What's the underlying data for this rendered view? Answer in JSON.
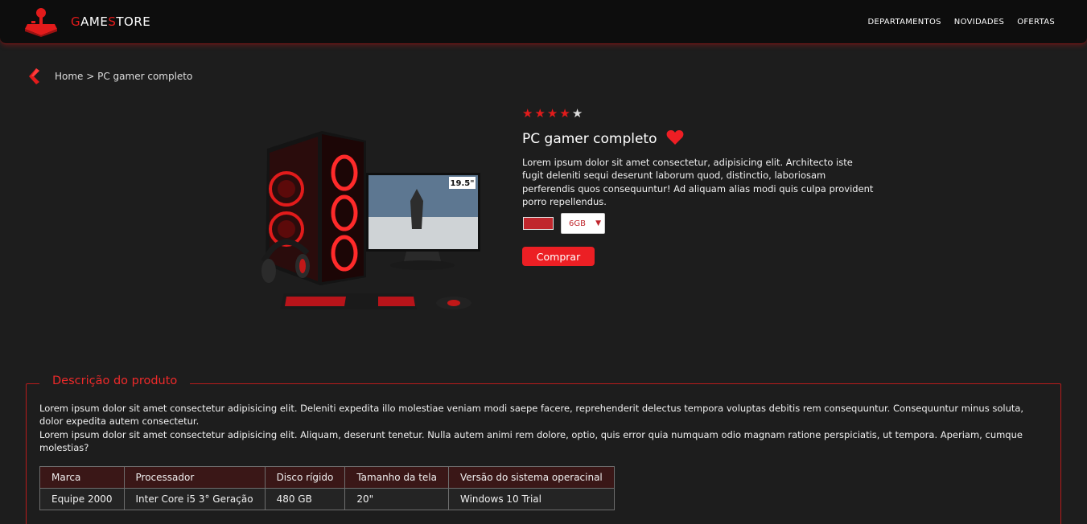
{
  "header": {
    "brand": {
      "g": "G",
      "ame": "AME",
      "s": "S",
      "tore": "TORE"
    },
    "nav": [
      "DEPARTAMENTOS",
      "NOVIDADES",
      "OFERTAS"
    ],
    "logo_icon": "joystick-icon"
  },
  "breadcrumb": {
    "text": "Home > PC gamer completo",
    "back_icon": "chevron-left-icon"
  },
  "product": {
    "image_icon": "gaming-pc-setup-image",
    "monitor_label": "19.5\"",
    "rating": 4,
    "rating_max": 5,
    "title": "PC gamer completo",
    "favorite_icon": "heart-icon",
    "description": "Lorem ipsum dolor sit amet consectetur, adipisicing elit. Architecto iste fugit deleniti sequi deserunt laborum quod, distinctio, laboriosam perferendis quos consequuntur! Ad aliquam alias modi quis culpa provident porro repellendus.",
    "color_swatch": "#c0272d",
    "memory_option": "6GB",
    "buy_label": "Comprar"
  },
  "details": {
    "legend": "Descrição do produto",
    "paragraph1": "Lorem ipsum dolor sit amet consectetur adipisicing elit. Deleniti expedita illo molestiae veniam modi saepe facere, reprehenderit delectus tempora voluptas debitis rem consequuntur. Consequuntur minus soluta, dolor expedita autem consectetur.",
    "paragraph2": "Lorem ipsum dolor sit amet consectetur adipisicing elit. Aliquam, deserunt tenetur. Nulla autem animi rem dolore, optio, quis error quia numquam odio magnam ratione perspiciatis, ut tempora. Aperiam, cumque molestias?",
    "table": {
      "headers": [
        "Marca",
        "Processador",
        "Disco rígido",
        "Tamanho da tela",
        "Versão do sistema operacinal"
      ],
      "row": [
        "Equipe 2000",
        "Inter Core i5 3° Geração",
        "480 GB",
        "20\"",
        "Windows 10 Trial"
      ]
    }
  },
  "colors": {
    "accent": "#ec1f24",
    "background": "#1d1d1d",
    "header": "#0d0d0d"
  }
}
